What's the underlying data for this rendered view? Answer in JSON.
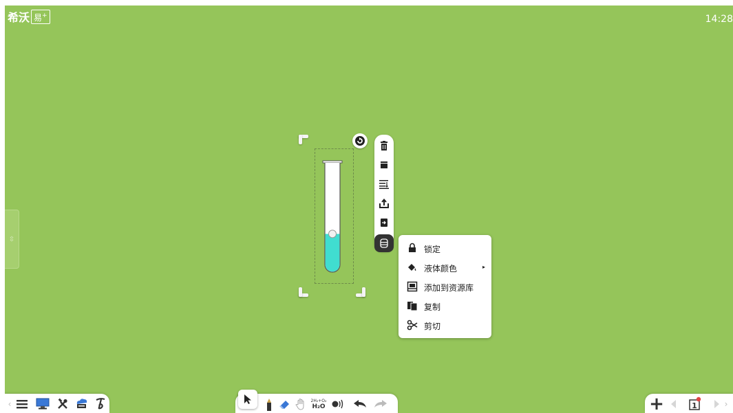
{
  "app": {
    "logo_text": "希沃",
    "logo_box": "易",
    "logo_sup": "+"
  },
  "clock": {
    "time": "14:28"
  },
  "side_panel": {
    "handle_glyph": "⇳"
  },
  "object": {
    "type": "test-tube",
    "liquid_color": "#40ddd0",
    "liquid_level": 0.35
  },
  "object_toolbar": {
    "buttons": [
      {
        "name": "delete-icon"
      },
      {
        "name": "bring-to-top-icon"
      },
      {
        "name": "align-layers-icon"
      },
      {
        "name": "upload-icon"
      },
      {
        "name": "export-icon"
      },
      {
        "name": "more-menu-icon",
        "active": true
      }
    ]
  },
  "context_menu": {
    "items": [
      {
        "label": "锁定",
        "icon": "lock-icon"
      },
      {
        "label": "液体颜色",
        "icon": "paint-bucket-icon",
        "submenu_arrow": "▸"
      },
      {
        "label": "添加到资源库",
        "icon": "add-to-library-icon"
      },
      {
        "label": "复制",
        "icon": "copy-icon"
      },
      {
        "label": "剪切",
        "icon": "scissors-icon"
      }
    ]
  },
  "bottom_toolbar": {
    "left": {
      "items": [
        "menu-icon",
        "desktop-icon",
        "tools-icon",
        "cloud-courseware-icon",
        "handwriting-icon"
      ]
    },
    "middle": {
      "items": [
        "select-arrow-icon",
        "pen-icon",
        "eraser-icon",
        "roam-hand-icon",
        "chemistry-formula-icon",
        "sound-icon",
        "undo-icon",
        "redo-icon"
      ],
      "chem_top": "2H₂+O₂",
      "chem_bottom": "H₂O"
    },
    "right": {
      "add_label": "+",
      "page_number": "1"
    }
  },
  "colors": {
    "canvas_bg": "#95c55a",
    "toolbar_active": "#333333",
    "liquid": "#40ddd0"
  }
}
